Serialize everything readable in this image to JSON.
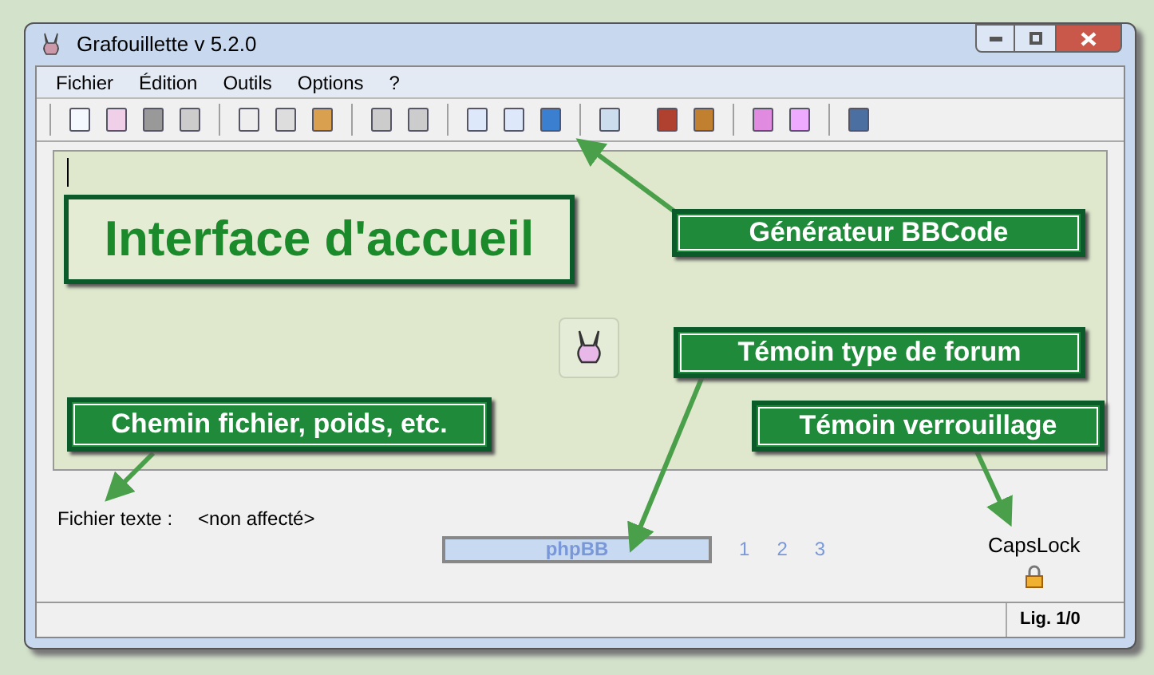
{
  "window": {
    "title": "Grafouillette v 5.2.0"
  },
  "menu": [
    "Fichier",
    "Édition",
    "Outils",
    "Options",
    "?"
  ],
  "file_info": {
    "label": "Fichier texte :",
    "value": "<non affecté>"
  },
  "forum_indicator": {
    "label": "phpBB",
    "pages": [
      "1",
      "2",
      "3"
    ]
  },
  "lock_indicator": {
    "label": "CapsLock"
  },
  "status_bar": {
    "position": "Lig. 1/0"
  },
  "annotations": [
    {
      "kind": "title",
      "text": "Interface d'accueil"
    },
    {
      "kind": "callout",
      "text": "Générateur BBCode"
    },
    {
      "kind": "callout",
      "text": "Témoin type de forum"
    },
    {
      "kind": "callout",
      "text": "Chemin fichier, poids, etc."
    },
    {
      "kind": "callout",
      "text": "Témoin verrouillage"
    }
  ]
}
